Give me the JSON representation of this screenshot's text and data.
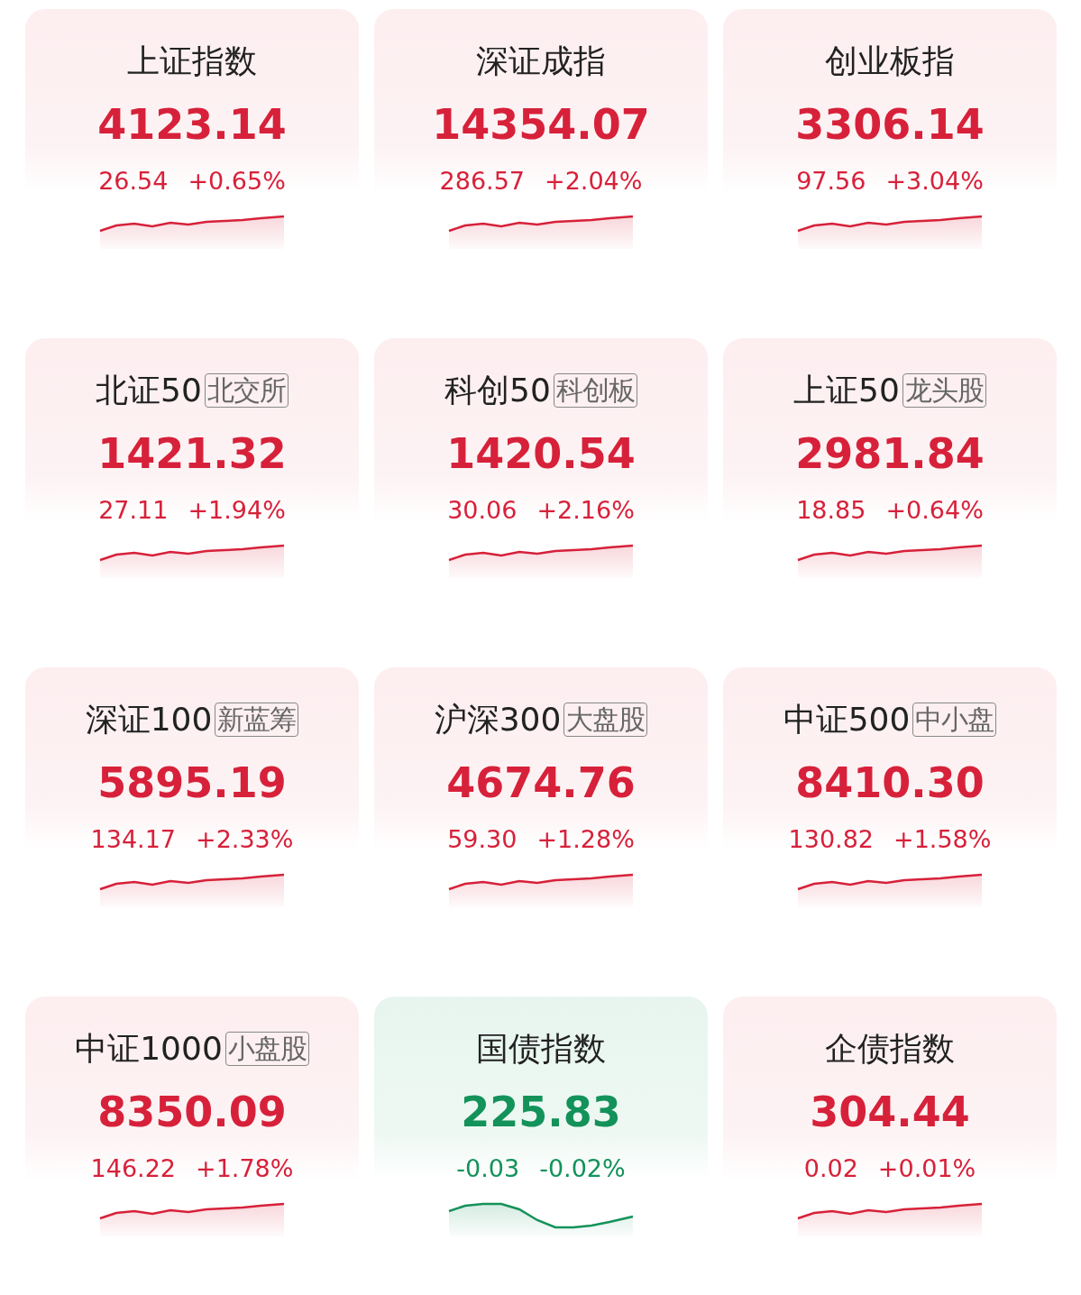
{
  "indices": [
    {
      "name": "上证指数",
      "value": "4123.14",
      "change": "26.54",
      "percent": "+0.65%",
      "kind": "up"
    },
    {
      "name": "深证成指",
      "value": "14354.07",
      "change": "286.57",
      "percent": "+2.04%",
      "kind": "up"
    },
    {
      "name": "创业板指",
      "value": "3306.14",
      "change": "97.56",
      "percent": "+3.04%",
      "kind": "up"
    },
    {
      "name": "北证50",
      "tag": "北交所",
      "value": "1421.32",
      "change": "27.11",
      "percent": "+1.94%",
      "kind": "up"
    },
    {
      "name": "科创50",
      "tag": "科创板",
      "value": "1420.54",
      "change": "30.06",
      "percent": "+2.16%",
      "kind": "up"
    },
    {
      "name": "上证50",
      "tag": "龙头股",
      "value": "2981.84",
      "change": "18.85",
      "percent": "+0.64%",
      "kind": "up"
    },
    {
      "name": "深证100",
      "tag": "新蓝筹",
      "value": "5895.19",
      "change": "134.17",
      "percent": "+2.33%",
      "kind": "up"
    },
    {
      "name": "沪深300",
      "tag": "大盘股",
      "value": "4674.76",
      "change": "59.30",
      "percent": "+1.28%",
      "kind": "up"
    },
    {
      "name": "中证500",
      "tag": "中小盘",
      "value": "8410.30",
      "change": "130.82",
      "percent": "+1.58%",
      "kind": "up"
    },
    {
      "name": "中证1000",
      "tag": "小盘股",
      "value": "8350.09",
      "change": "146.22",
      "percent": "+1.78%",
      "kind": "up"
    },
    {
      "name": "国债指数",
      "value": "225.83",
      "change": "-0.03",
      "percent": "-0.02%",
      "kind": "down"
    },
    {
      "name": "企债指数",
      "value": "304.44",
      "change": "0.02",
      "percent": "+0.01%",
      "kind": "up"
    }
  ]
}
